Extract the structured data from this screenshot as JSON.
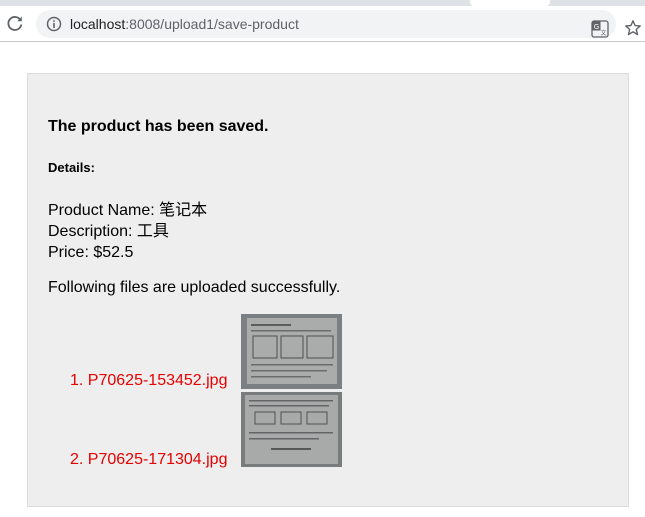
{
  "browser": {
    "url_host": "localhost",
    "url_path": ":8008/upload1/save-product"
  },
  "page": {
    "saved_message": "The product has been saved.",
    "details_heading": "Details:",
    "product_name_label": "Product Name: ",
    "product_name_value": "笔记本",
    "description_label": "Description: ",
    "description_value": "工具",
    "price_label": "Price: ",
    "price_value": "$52.5",
    "files_intro": "Following files are uploaded successfully.",
    "files": [
      {
        "index": "1. ",
        "name": "P70625-153452.jpg"
      },
      {
        "index": "2. ",
        "name": "P70625-171304.jpg"
      }
    ]
  },
  "colors": {
    "file_link": "#e60000",
    "panel_bg": "#eeeeee"
  }
}
